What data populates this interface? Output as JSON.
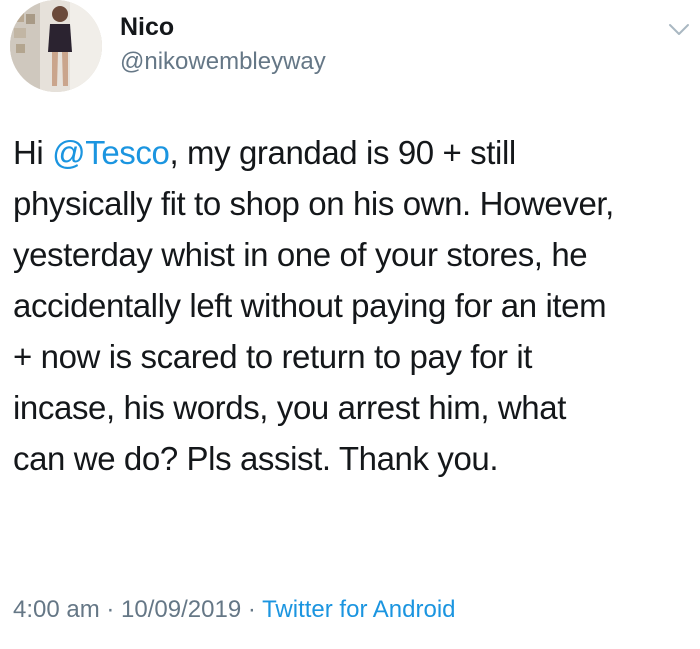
{
  "user": {
    "name": "Nico",
    "handle": "@nikowembleyway"
  },
  "tweet": {
    "lines": [
      {
        "pre": "Hi ",
        "mention": "@Tesco",
        "post": ", my grandad is 90 + still"
      },
      {
        "text": "physically fit to shop on his own. However,"
      },
      {
        "text": "yesterday whist in one of your stores, he"
      },
      {
        "text": "accidentally left without paying for an item"
      },
      {
        "text": "+ now is scared to return to pay for it"
      },
      {
        "text": "incase, his words, you arrest him, what"
      },
      {
        "text": "can we do? Pls assist. Thank you."
      }
    ]
  },
  "meta": {
    "time": "4:00 am",
    "separator": " · ",
    "date": "10/09/2019",
    "source": "Twitter for Android"
  },
  "icons": {
    "caret": "chevron-down-icon",
    "avatar": "avatar"
  },
  "colors": {
    "link": "#1b95e0",
    "secondary_text": "#657786",
    "primary_text": "#14171a"
  }
}
